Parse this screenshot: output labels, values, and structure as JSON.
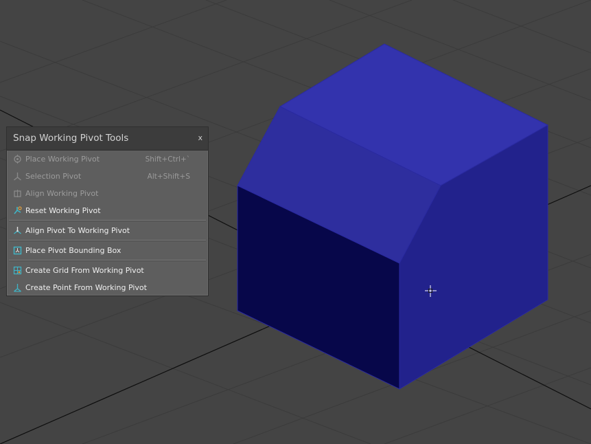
{
  "panel": {
    "title": "Snap Working Pivot Tools",
    "close_label": "x"
  },
  "menu": [
    {
      "label": "Place Working Pivot",
      "shortcut": "Shift+Ctrl+`",
      "enabled": false,
      "icon": "place-working-pivot-icon"
    },
    {
      "label": "Selection Pivot",
      "shortcut": "Alt+Shift+S",
      "enabled": false,
      "icon": "selection-pivot-icon"
    },
    {
      "label": "Align Working Pivot",
      "shortcut": "",
      "enabled": false,
      "icon": "align-working-pivot-icon"
    },
    {
      "label": "Reset Working Pivot",
      "shortcut": "",
      "enabled": true,
      "icon": "reset-working-pivot-icon"
    },
    {
      "label": "Align Pivot To Working Pivot",
      "shortcut": "",
      "enabled": true,
      "icon": "align-pivot-icon"
    },
    {
      "label": "Place Pivot Bounding Box",
      "shortcut": "",
      "enabled": true,
      "icon": "bounding-box-icon"
    },
    {
      "label": "Create Grid From Working Pivot",
      "shortcut": "",
      "enabled": true,
      "icon": "grid-icon"
    },
    {
      "label": "Create Point From Working Pivot",
      "shortcut": "",
      "enabled": true,
      "icon": "point-icon"
    }
  ],
  "colors": {
    "viewport_bg": "#444444",
    "grid_line": "#3a3a3a",
    "grid_axis": "#0a0a0a",
    "box_top": "#3030a8",
    "box_bevel": "#2c2c9a",
    "box_front": "#08084a",
    "box_right": "#20208a",
    "icon_accent": "#3fb6c8"
  }
}
